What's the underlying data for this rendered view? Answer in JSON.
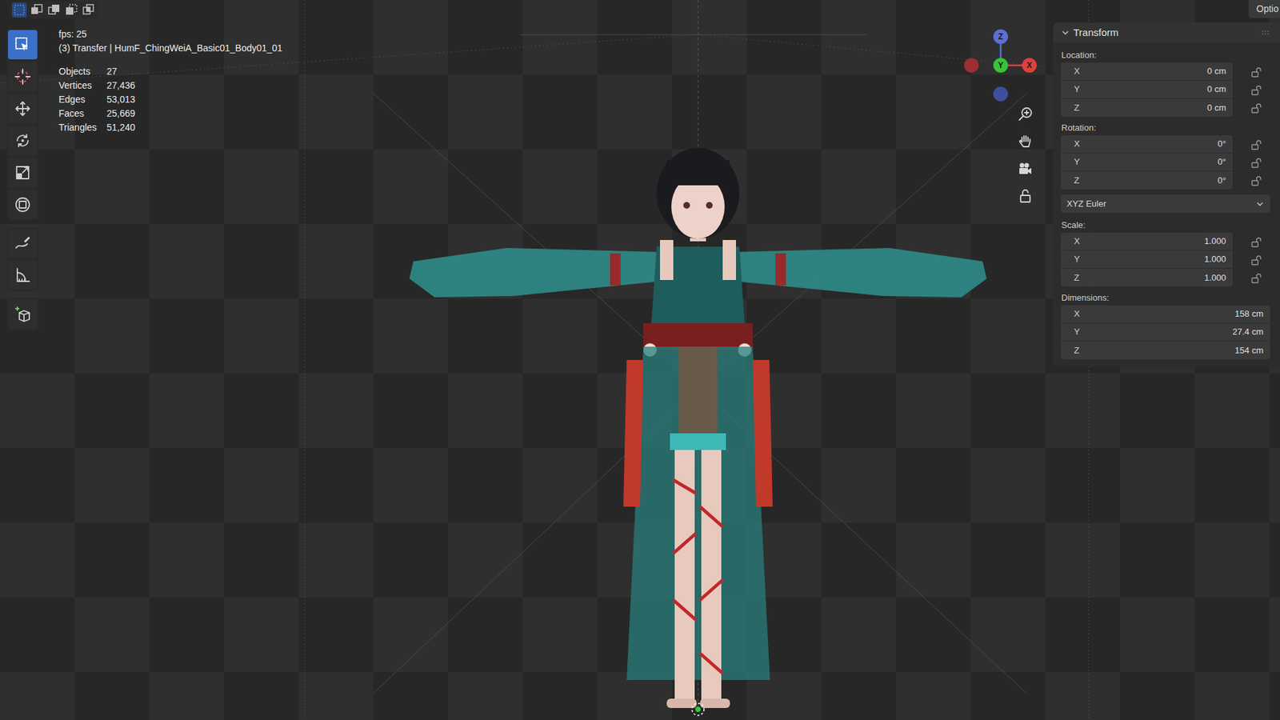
{
  "select_modes": [
    {
      "selected": true
    },
    {
      "selected": false
    },
    {
      "selected": false
    },
    {
      "selected": false
    },
    {
      "selected": false
    }
  ],
  "toolbar": {
    "tools": [
      {
        "selected": true
      },
      {
        "selected": false
      },
      {
        "selected": false
      },
      {
        "selected": false
      },
      {
        "selected": false
      },
      {
        "selected": false
      },
      {
        "selected": false
      },
      {
        "selected": false
      },
      {
        "selected": false
      }
    ]
  },
  "overlay": {
    "fps": "fps: 25",
    "object_line": "(3) Transfer | HumF_ChingWeiA_Basic01_Body01_01",
    "stats": [
      {
        "label": "Objects",
        "value": "27"
      },
      {
        "label": "Vertices",
        "value": "27,436"
      },
      {
        "label": "Edges",
        "value": "53,013"
      },
      {
        "label": "Faces",
        "value": "25,669"
      },
      {
        "label": "Triangles",
        "value": "51,240"
      }
    ]
  },
  "gizmo": {
    "axes": [
      {
        "label": "Z",
        "color": "#5a6fd8"
      },
      {
        "label": "Y",
        "color": "#36c43a"
      },
      {
        "label": "X",
        "color": "#e0403c"
      }
    ],
    "negative_axes": [
      {
        "color": "#9a3030"
      },
      {
        "color": "#3f4f9e"
      }
    ]
  },
  "options_tab": {
    "label": "Optio"
  },
  "transform_panel": {
    "title": "Transform",
    "expanded": true,
    "sections": [
      {
        "kind": "fields",
        "label": "Location:",
        "fields": [
          {
            "axis": "X",
            "value": "0 cm",
            "locked": false
          },
          {
            "axis": "Y",
            "value": "0 cm",
            "locked": false
          },
          {
            "axis": "Z",
            "value": "0 cm",
            "locked": false
          }
        ]
      },
      {
        "kind": "fields",
        "label": "Rotation:",
        "fields": [
          {
            "axis": "X",
            "value": "0°",
            "locked": false
          },
          {
            "axis": "Y",
            "value": "0°",
            "locked": false
          },
          {
            "axis": "Z",
            "value": "0°",
            "locked": false
          }
        ]
      },
      {
        "kind": "dropdown",
        "value": "XYZ Euler"
      },
      {
        "kind": "fields",
        "label": "Scale:",
        "fields": [
          {
            "axis": "X",
            "value": "1.000",
            "locked": false
          },
          {
            "axis": "Y",
            "value": "1.000",
            "locked": false
          },
          {
            "axis": "Z",
            "value": "1.000",
            "locked": false
          }
        ]
      },
      {
        "kind": "fields",
        "label": "Dimensions:",
        "fields": [
          {
            "axis": "X",
            "value": "158 cm"
          },
          {
            "axis": "Y",
            "value": "27.4 cm"
          },
          {
            "axis": "Z",
            "value": "154 cm"
          }
        ]
      }
    ]
  }
}
